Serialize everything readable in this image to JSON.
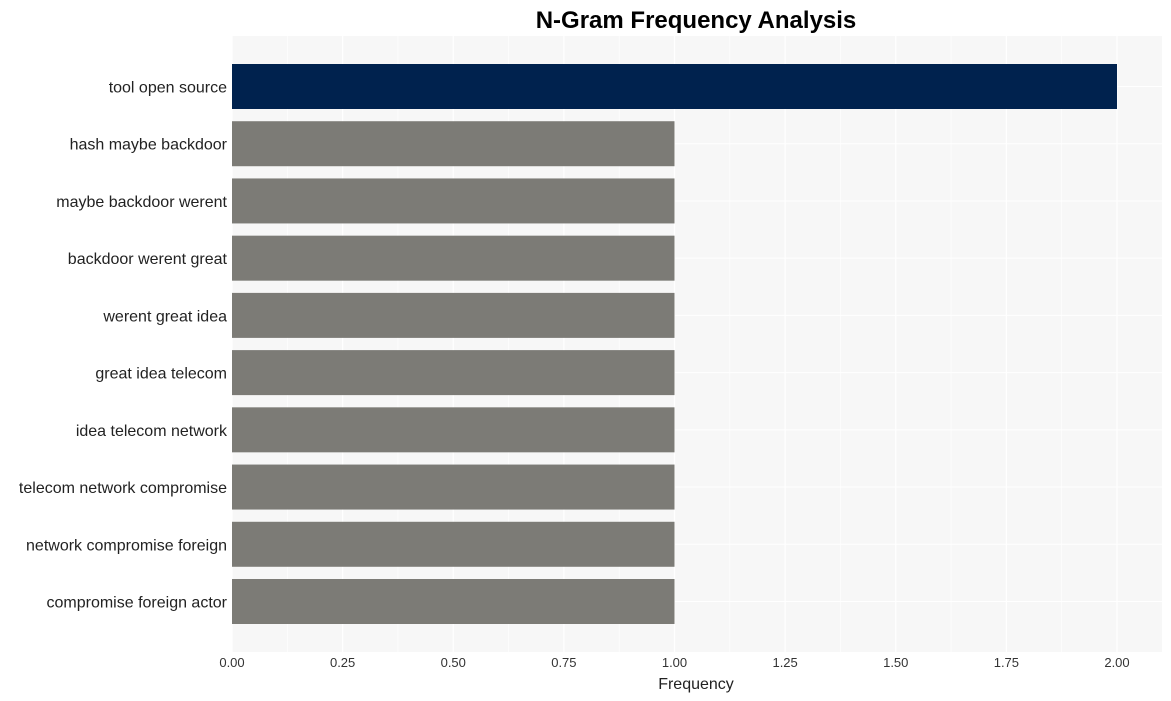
{
  "chart_data": {
    "type": "bar",
    "orientation": "horizontal",
    "title": "N-Gram Frequency Analysis",
    "xlabel": "Frequency",
    "ylabel": "",
    "xlim": [
      0,
      2.1
    ],
    "xticks": [
      "0.00",
      "0.25",
      "0.50",
      "0.75",
      "1.00",
      "1.25",
      "1.50",
      "1.75",
      "2.00"
    ],
    "grid": true,
    "categories": [
      "tool open source",
      "hash maybe backdoor",
      "maybe backdoor werent",
      "backdoor werent great",
      "werent great idea",
      "great idea telecom",
      "idea telecom network",
      "telecom network compromise",
      "network compromise foreign",
      "compromise foreign actor"
    ],
    "values": [
      2,
      1,
      1,
      1,
      1,
      1,
      1,
      1,
      1,
      1
    ],
    "colors": {
      "highlight": "#00224e",
      "default": "#7c7b76",
      "plot_background": "#f7f7f7",
      "grid": "#ffffff"
    }
  }
}
